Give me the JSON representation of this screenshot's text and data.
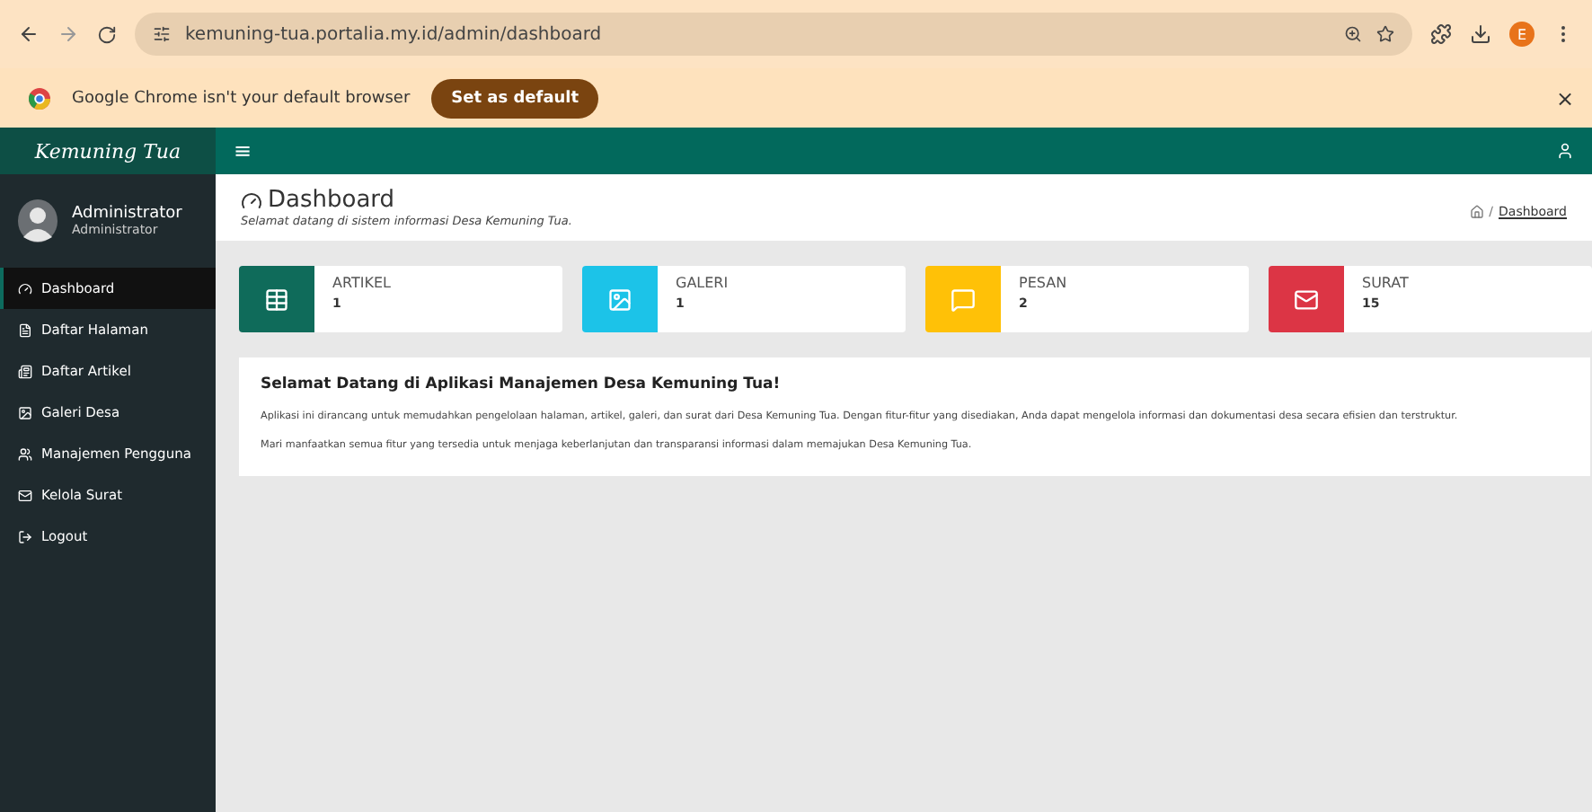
{
  "browser": {
    "url": "kemuning-tua.portalia.my.id/admin/dashboard",
    "profile_initial": "E"
  },
  "infobar": {
    "message": "Google Chrome isn't your default browser",
    "button": "Set as default",
    "close": "×"
  },
  "header": {
    "brand": "Kemuning Tua",
    "menu": "≡"
  },
  "user": {
    "name": "Administrator",
    "role": "Administrator"
  },
  "sidebar": {
    "items": [
      {
        "label": "Dashboard",
        "kind": "dashboard",
        "selected": true
      },
      {
        "label": "Daftar Halaman",
        "kind": "page",
        "selected": false
      },
      {
        "label": "Daftar Artikel",
        "kind": "article",
        "selected": false
      },
      {
        "label": "Galeri Desa",
        "kind": "gallery",
        "selected": false
      },
      {
        "label": "Manajemen Pengguna",
        "kind": "users",
        "selected": false
      },
      {
        "label": "Kelola Surat",
        "kind": "mail",
        "selected": false
      },
      {
        "label": "Logout",
        "kind": "logout",
        "selected": false
      }
    ]
  },
  "page": {
    "title": "Dashboard",
    "subtitle": "Selamat datang di sistem informasi Desa Kemuning Tua.",
    "breadcrumb": [
      "/",
      "Dashboard"
    ]
  },
  "stats": [
    {
      "label": "ARTIKEL",
      "value": "1",
      "kind": "article",
      "color": "#0f6b5a"
    },
    {
      "label": "GALERI",
      "value": "1",
      "kind": "gallery",
      "color": "#1cc3e8"
    },
    {
      "label": "PESAN",
      "value": "2",
      "kind": "message",
      "color": "#ffc107"
    },
    {
      "label": "SURAT",
      "value": "15",
      "kind": "mail",
      "color": "#dc3545"
    }
  ],
  "welcome": {
    "title": "Selamat Datang di Aplikasi Manajemen Desa Kemuning Tua!",
    "paragraphs": [
      "Aplikasi ini dirancang untuk memudahkan pengelolaan halaman, artikel, galeri, dan surat dari Desa Kemuning Tua. Dengan fitur-fitur yang disediakan, Anda dapat mengelola informasi dan dokumentasi desa secara efisien dan terstruktur.",
      "Mari manfaatkan semua fitur yang tersedia untuk menjaga keberlanjutan dan transparansi informasi dalam memajukan Desa Kemuning Tua."
    ]
  }
}
